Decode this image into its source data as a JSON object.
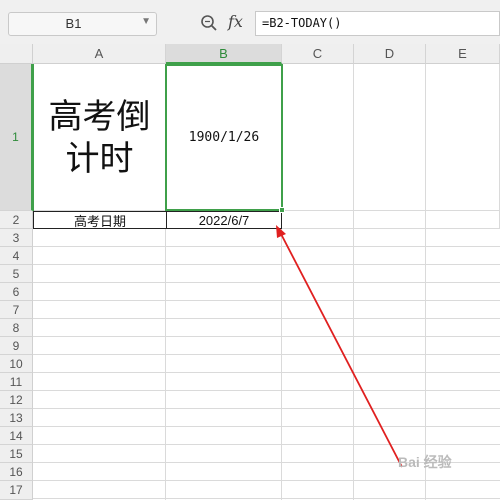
{
  "formula_bar": {
    "name_box": "B1",
    "fx_label": "fx",
    "formula": "=B2-TODAY()"
  },
  "columns": [
    "A",
    "B",
    "C",
    "D",
    "E"
  ],
  "rows": [
    "1",
    "2",
    "3",
    "4",
    "5",
    "6",
    "7",
    "8",
    "9",
    "10",
    "11",
    "12",
    "13",
    "14",
    "15",
    "16",
    "17"
  ],
  "cells": {
    "A1": "高考倒\n计时",
    "B1": "1900/1/26",
    "A2": "高考日期",
    "B2": "2022/6/7"
  },
  "selection": {
    "cell": "B1"
  },
  "colors": {
    "accent": "#3fa04a",
    "arrow": "#e02020"
  },
  "watermark": "Bai 经验"
}
